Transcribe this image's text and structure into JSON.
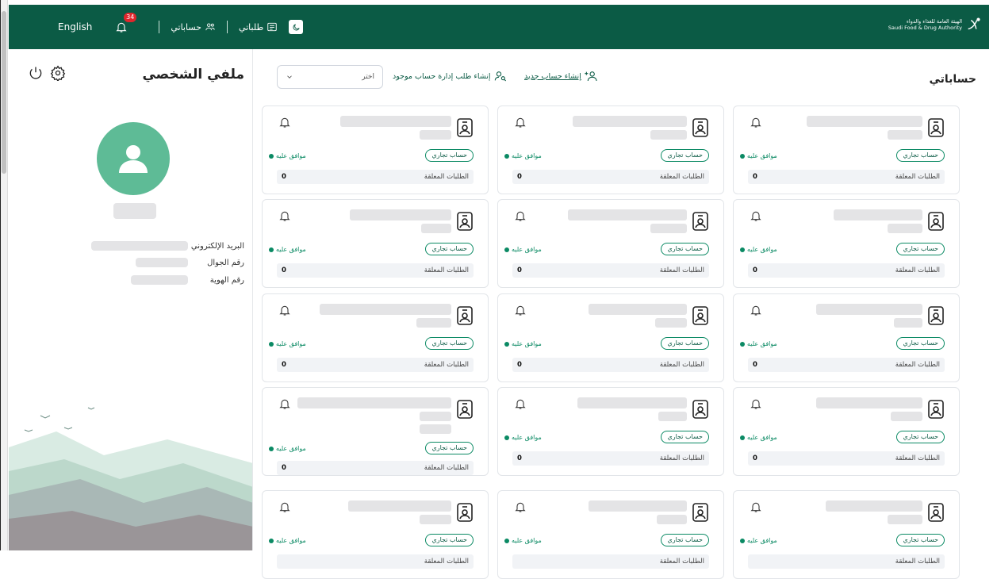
{
  "topbar": {
    "lang": "English",
    "notif_count": "34",
    "accounts_label": "حساباتي",
    "requests_label": "طلباتي",
    "logo_ar": "الهيئة العامة للغذاء والدواء",
    "logo_en": "Saudi Food & Drug Authority",
    "colors": {
      "header": "#0b5b45",
      "accent": "#0b8a64",
      "avatar": "#5ebb96",
      "badge": "#e0262c"
    }
  },
  "profile": {
    "title": "ملفي الشخصي",
    "fields": [
      {
        "label": "البريد الإلكتروني"
      },
      {
        "label": "رقم الجوال"
      },
      {
        "label": "رقم الهوية"
      }
    ]
  },
  "main": {
    "title": "حساباتي",
    "create_account": "إنشاء حساب جديد",
    "manage_request": "إنشاء طلب إدارة حساب موجود",
    "select_placeholder": "اختر"
  },
  "cards": [
    {
      "tag": "حساب تجاري",
      "status": "موافق عليه",
      "pending_label": "الطلبات المعلقة",
      "pending_count": "0"
    },
    {
      "tag": "حساب تجاري",
      "status": "موافق عليه",
      "pending_label": "الطلبات المعلقة",
      "pending_count": "0"
    },
    {
      "tag": "حساب تجاري",
      "status": "موافق عليه",
      "pending_label": "الطلبات المعلقة",
      "pending_count": "0"
    },
    {
      "tag": "حساب تجاري",
      "status": "موافق عليه",
      "pending_label": "الطلبات المعلقة",
      "pending_count": "0"
    },
    {
      "tag": "حساب تجاري",
      "status": "موافق عليه",
      "pending_label": "الطلبات المعلقة",
      "pending_count": "0"
    },
    {
      "tag": "حساب تجاري",
      "status": "موافق عليه",
      "pending_label": "الطلبات المعلقة",
      "pending_count": "0"
    },
    {
      "tag": "حساب تجاري",
      "status": "موافق عليه",
      "pending_label": "الطلبات المعلقة",
      "pending_count": "0"
    },
    {
      "tag": "حساب تجاري",
      "status": "موافق عليه",
      "pending_label": "الطلبات المعلقة",
      "pending_count": "0"
    },
    {
      "tag": "حساب تجاري",
      "status": "موافق عليه",
      "pending_label": "الطلبات المعلقة",
      "pending_count": "0"
    },
    {
      "tag": "حساب تجاري",
      "status": "موافق عليه",
      "pending_label": "الطلبات المعلقة",
      "pending_count": "0"
    },
    {
      "tag": "حساب تجاري",
      "status": "موافق عليه",
      "pending_label": "الطلبات المعلقة",
      "pending_count": "0"
    },
    {
      "tag": "حساب تجاري",
      "status": "موافق عليه",
      "pending_label": "الطلبات المعلقة",
      "pending_count": "0"
    },
    {
      "tag": "حساب تجاري",
      "status": "موافق عليه",
      "pending_label": "الطلبات المعلقة",
      "pending_count": ""
    },
    {
      "tag": "حساب تجاري",
      "status": "موافق عليه",
      "pending_label": "الطلبات المعلقة",
      "pending_count": ""
    },
    {
      "tag": "حساب تجاري",
      "status": "موافق عليه",
      "pending_label": "الطلبات المعلقة",
      "pending_count": ""
    }
  ]
}
